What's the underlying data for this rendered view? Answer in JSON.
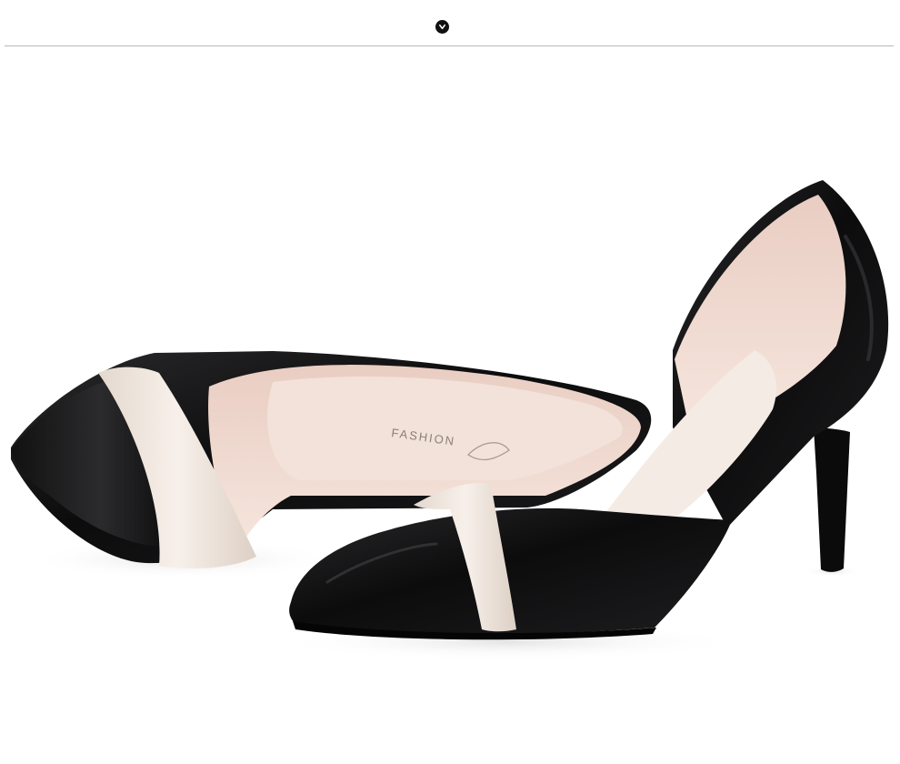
{
  "header": {
    "collapse_icon": "chevron-down-icon"
  },
  "photo": {
    "insole_logo_text": "FASHION"
  },
  "colors": {
    "background": "#ffffff",
    "divider": "#b9b9b9",
    "leather": "#0f0f10",
    "lining": "#f0d9cf",
    "trim": "#efe6de"
  }
}
